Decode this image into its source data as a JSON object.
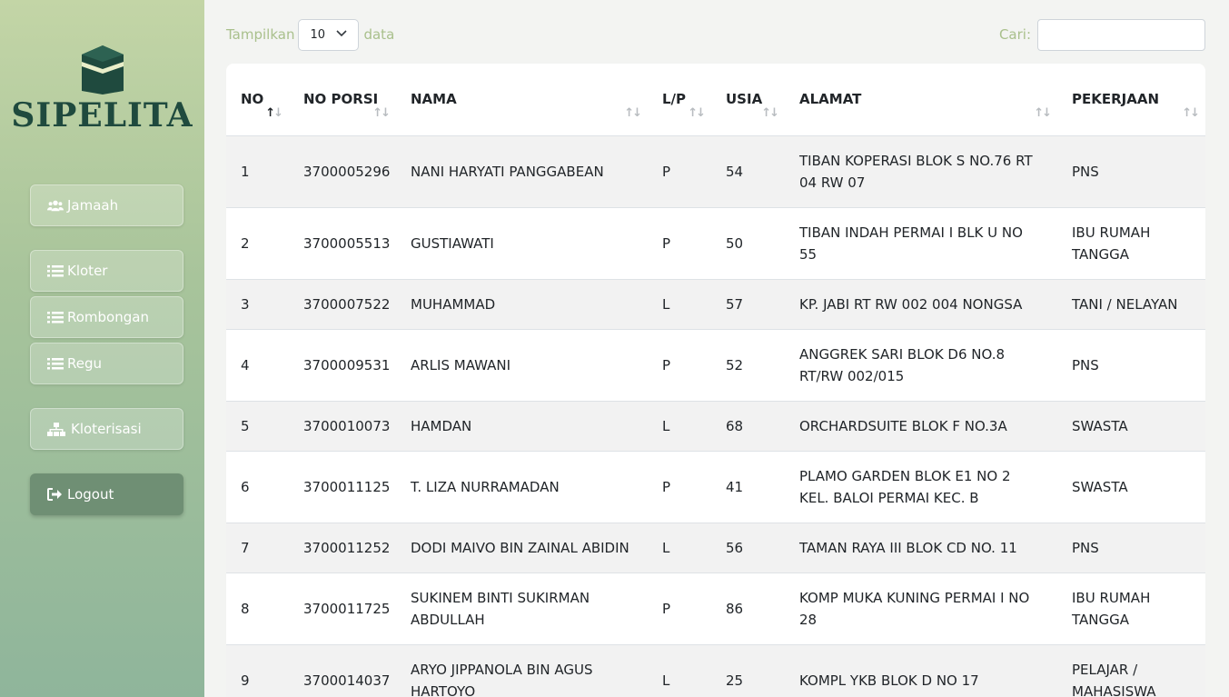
{
  "app": {
    "logo_text": "SIPELITA"
  },
  "sidebar": {
    "items": [
      {
        "label": "Jamaah",
        "icon": "users-icon"
      },
      {
        "label": "Kloter",
        "icon": "list-icon"
      },
      {
        "label": "Rombongan",
        "icon": "list-icon"
      },
      {
        "label": "Regu",
        "icon": "list-icon"
      },
      {
        "label": "Kloterisasi",
        "icon": "sitemap-icon"
      },
      {
        "label": "Logout",
        "icon": "sign-out-icon"
      }
    ]
  },
  "controls": {
    "show_label": "Tampilkan",
    "page_size": "10",
    "data_label": "data",
    "search_label": "Cari:",
    "search_value": ""
  },
  "table": {
    "columns": [
      "NO",
      "NO PORSI",
      "NAMA",
      "L/P",
      "USIA",
      "ALAMAT",
      "PEKERJAAN"
    ],
    "rows": [
      [
        "1",
        "3700005296",
        "NANI HARYATI PANGGABEAN",
        "P",
        "54",
        "TIBAN KOPERASI BLOK S NO.76 RT 04 RW 07",
        "PNS"
      ],
      [
        "2",
        "3700005513",
        "GUSTIAWATI",
        "P",
        "50",
        "TIBAN INDAH PERMAI I BLK U NO 55",
        "IBU RUMAH TANGGA"
      ],
      [
        "3",
        "3700007522",
        "MUHAMMAD",
        "L",
        "57",
        "KP. JABI RT RW 002 004 NONGSA",
        "TANI / NELAYAN"
      ],
      [
        "4",
        "3700009531",
        "ARLIS MAWANI",
        "P",
        "52",
        "ANGGREK SARI BLOK D6 NO.8 RT/RW 002/015",
        "PNS"
      ],
      [
        "5",
        "3700010073",
        "HAMDAN",
        "L",
        "68",
        "ORCHARDSUITE BLOK F NO.3A",
        "SWASTA"
      ],
      [
        "6",
        "3700011125",
        "T. LIZA NURRAMADAN",
        "P",
        "41",
        "PLAMO GARDEN BLOK E1 NO 2 KEL. BALOI PERMAI KEC. B",
        "SWASTA"
      ],
      [
        "7",
        "3700011252",
        "DODI MAIVO BIN ZAINAL ABIDIN",
        "L",
        "56",
        "TAMAN RAYA III BLOK CD NO. 11",
        "PNS"
      ],
      [
        "8",
        "3700011725",
        "SUKINEM BINTI SUKIRMAN ABDULLAH",
        "P",
        "86",
        "KOMP MUKA KUNING PERMAI I NO 28",
        "IBU RUMAH TANGGA"
      ],
      [
        "9",
        "3700014037",
        "ARYO JIPPANOLA BIN AGUS HARTOYO",
        "L",
        "25",
        "KOMPL YKB BLOK D NO 17",
        "PELAJAR / MAHASISWA"
      ]
    ]
  },
  "colors": {
    "sidebar_top": "#c3d5a6",
    "sidebar_bottom": "#8fb59b",
    "logo": "#1f4a3e",
    "logout_button": "#6f8f74",
    "control_label": "#a9c08c"
  }
}
